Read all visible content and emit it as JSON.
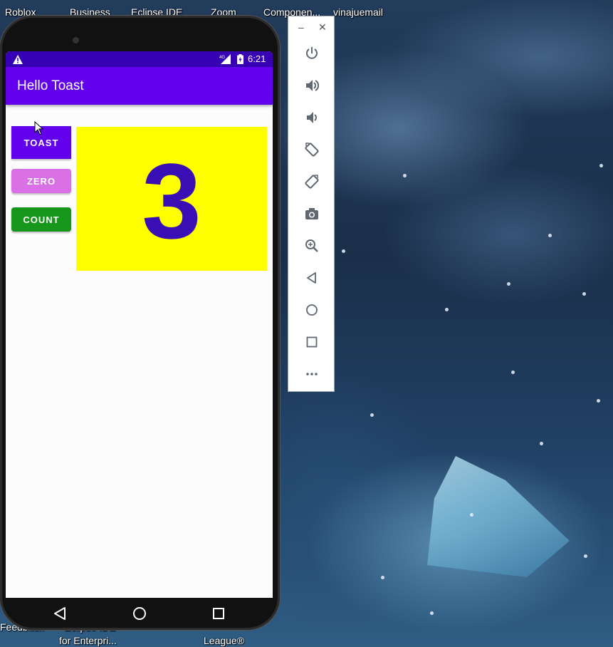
{
  "desktop": {
    "icon_labels": [
      "Roblox",
      "Business",
      "Eclipse IDE",
      "Zoom",
      "Componen...",
      "vinajuemail"
    ],
    "bottom_labels": [
      "Feedback",
      "Eclipse IDE",
      "for Enterpri...",
      "League®"
    ]
  },
  "phone": {
    "status_bar": {
      "time": "6:21",
      "network": "4G",
      "icons": [
        "warning-icon",
        "signal-icon",
        "battery-icon"
      ]
    },
    "app": {
      "title": "Hello Toast",
      "buttons": {
        "toast": "TOAST",
        "zero": "ZERO",
        "count": "COUNT"
      },
      "count_value": "3"
    },
    "nav": [
      "back-icon",
      "home-icon",
      "recents-icon"
    ]
  },
  "emulator_toolbar": {
    "window_controls": {
      "minimize": "–",
      "close": "✕"
    },
    "buttons": [
      "power-icon",
      "volume-up-icon",
      "volume-down-icon",
      "rotate-left-icon",
      "rotate-right-icon",
      "camera-icon",
      "zoom-icon",
      "back-icon",
      "home-icon",
      "overview-icon",
      "more-icon"
    ]
  },
  "colors": {
    "status_bar": "#3700b3",
    "app_bar": "#6200ee",
    "toast_button": "#6200ee",
    "zero_button": "#da70e6",
    "count_button": "#16961a",
    "count_background": "#ffff00",
    "count_text": "#3a0eb5"
  }
}
